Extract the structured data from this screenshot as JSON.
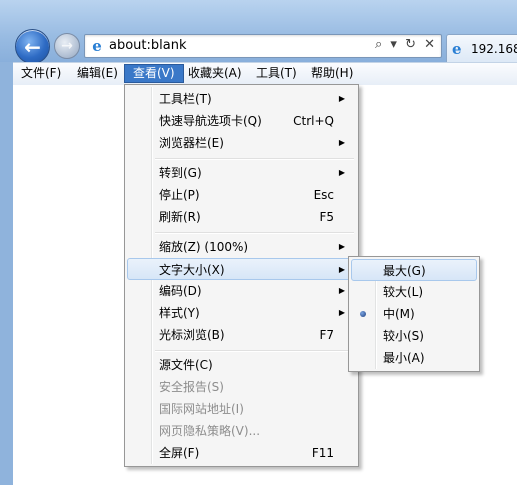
{
  "browser": {
    "address": "about:blank",
    "address_tools": "⌕ ▾ ↻ ✕",
    "tab_title": "192.168"
  },
  "menubar": [
    {
      "label": "文件(F)"
    },
    {
      "label": "编辑(E)"
    },
    {
      "label": "查看(V)"
    },
    {
      "label": "收藏夹(A)"
    },
    {
      "label": "工具(T)"
    },
    {
      "label": "帮助(H)"
    }
  ],
  "view_menu": {
    "toolbars": {
      "label": "工具栏(T)"
    },
    "quick_tabs": {
      "label": "快速导航选项卡(Q)",
      "shortcut": "Ctrl+Q"
    },
    "explorer_bars": {
      "label": "浏览器栏(E)"
    },
    "go_to": {
      "label": "转到(G)"
    },
    "stop": {
      "label": "停止(P)",
      "shortcut": "Esc"
    },
    "refresh": {
      "label": "刷新(R)",
      "shortcut": "F5"
    },
    "zoom": {
      "label": "缩放(Z) (100%)"
    },
    "text_size": {
      "label": "文字大小(X)"
    },
    "encoding": {
      "label": "编码(D)"
    },
    "style": {
      "label": "样式(Y)"
    },
    "caret_browsing": {
      "label": "光标浏览(B)",
      "shortcut": "F7"
    },
    "source": {
      "label": "源文件(C)"
    },
    "security_report": {
      "label": "安全报告(S)"
    },
    "intl_address": {
      "label": "国际网站地址(I)"
    },
    "privacy_policy": {
      "label": "网页隐私策略(V)..."
    },
    "full_screen": {
      "label": "全屏(F)",
      "shortcut": "F11"
    }
  },
  "text_size_menu": [
    {
      "label": "最大(G)"
    },
    {
      "label": "较大(L)"
    },
    {
      "label": "中(M)"
    },
    {
      "label": "较小(S)"
    },
    {
      "label": "最小(A)"
    }
  ]
}
